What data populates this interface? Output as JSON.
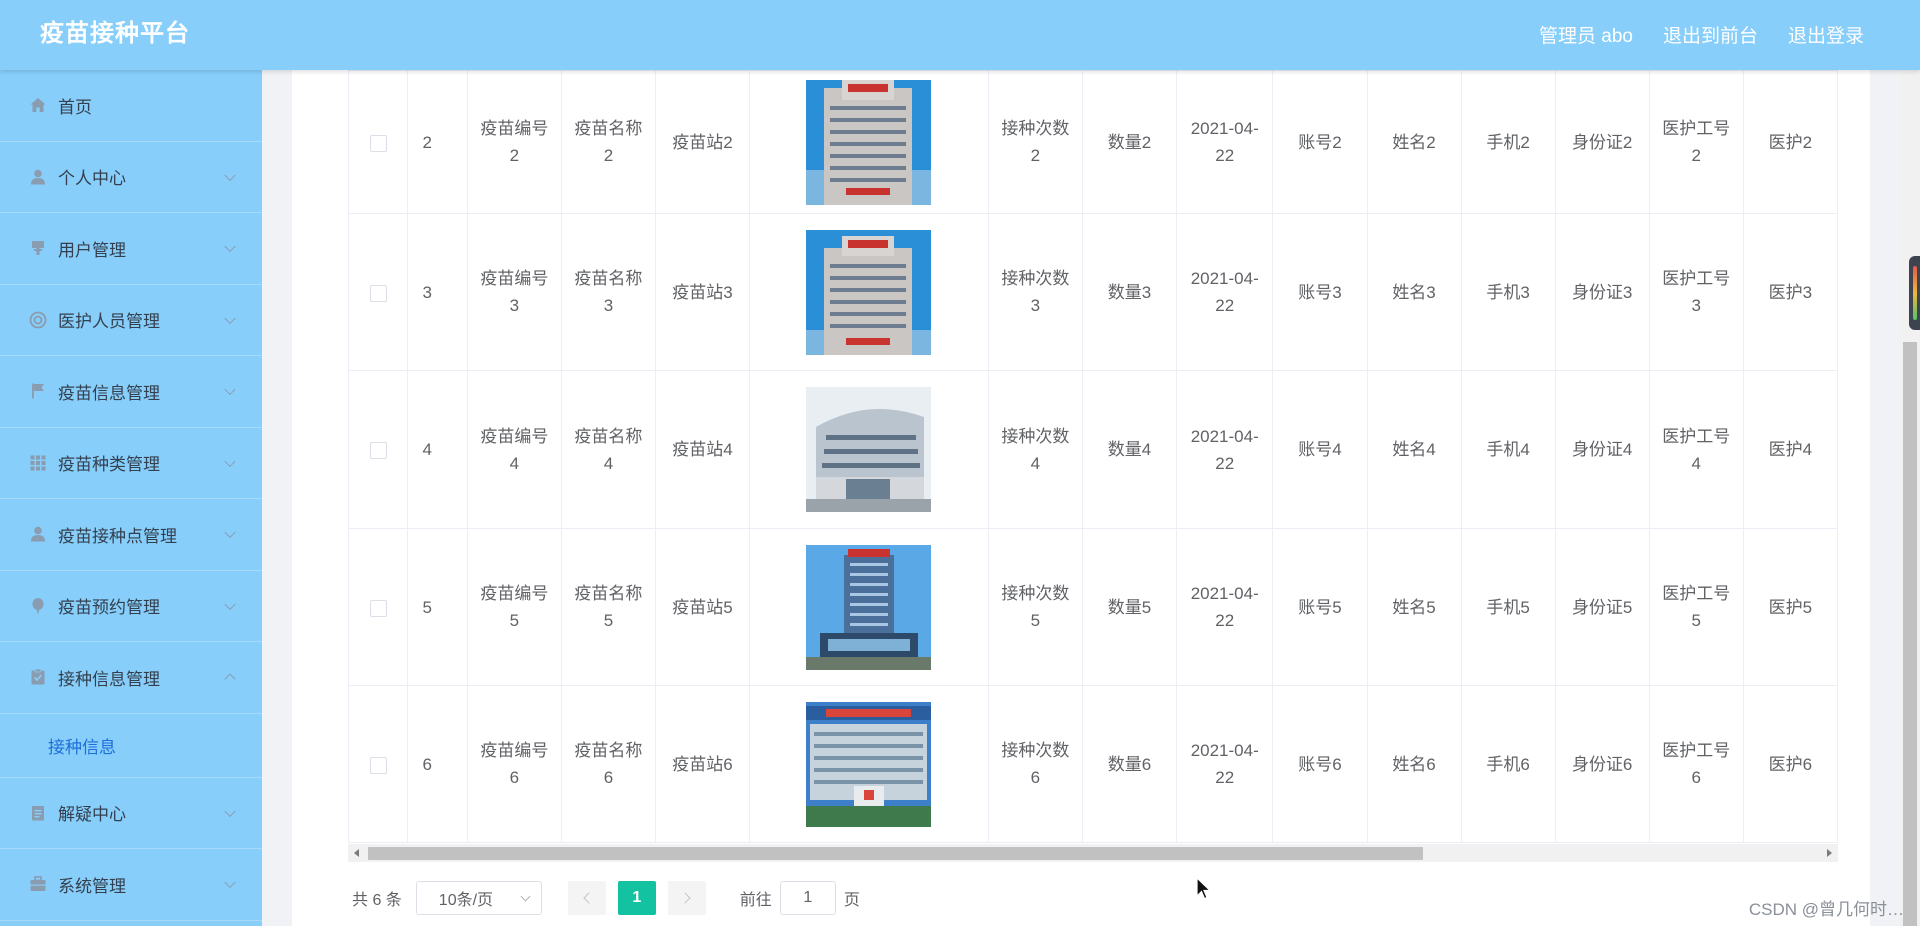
{
  "header": {
    "title": "疫苗接种平台",
    "user_label": "管理员 abo",
    "front_link": "退出到前台",
    "logout_link": "退出登录"
  },
  "sidebar": {
    "items": [
      {
        "label": "首页",
        "icon": "home-icon",
        "expandable": false
      },
      {
        "label": "个人中心",
        "icon": "user-icon",
        "expandable": true
      },
      {
        "label": "用户管理",
        "icon": "users-icon",
        "expandable": true
      },
      {
        "label": "医护人员管理",
        "icon": "lifebuoy-icon",
        "expandable": true
      },
      {
        "label": "疫苗信息管理",
        "icon": "flag-icon",
        "expandable": true
      },
      {
        "label": "疫苗种类管理",
        "icon": "grid-icon",
        "expandable": true
      },
      {
        "label": "疫苗接种点管理",
        "icon": "person-icon",
        "expandable": true
      },
      {
        "label": "疫苗预约管理",
        "icon": "balloon-icon",
        "expandable": true
      },
      {
        "label": "接种信息管理",
        "icon": "clipboard-check-icon",
        "expandable": true,
        "open": true
      },
      {
        "label": "解疑中心",
        "icon": "document-icon",
        "expandable": true
      },
      {
        "label": "系统管理",
        "icon": "briefcase-icon",
        "expandable": true
      }
    ],
    "submenu": {
      "label": "接种信息"
    }
  },
  "table": {
    "rows": [
      {
        "index": "2",
        "code": "疫苗编号2",
        "name": "疫苗名称2",
        "station": "疫苗站2",
        "times": "接种次数2",
        "qty": "数量2",
        "date": "2021-04-22",
        "account": "账号2",
        "person": "姓名2",
        "phone": "手机2",
        "idcard": "身份证2",
        "staff_id": "医护工号2",
        "staff_name": "医护2"
      },
      {
        "index": "3",
        "code": "疫苗编号3",
        "name": "疫苗名称3",
        "station": "疫苗站3",
        "times": "接种次数3",
        "qty": "数量3",
        "date": "2021-04-22",
        "account": "账号3",
        "person": "姓名3",
        "phone": "手机3",
        "idcard": "身份证3",
        "staff_id": "医护工号3",
        "staff_name": "医护3"
      },
      {
        "index": "4",
        "code": "疫苗编号4",
        "name": "疫苗名称4",
        "station": "疫苗站4",
        "times": "接种次数4",
        "qty": "数量4",
        "date": "2021-04-22",
        "account": "账号4",
        "person": "姓名4",
        "phone": "手机4",
        "idcard": "身份证4",
        "staff_id": "医护工号4",
        "staff_name": "医护4"
      },
      {
        "index": "5",
        "code": "疫苗编号5",
        "name": "疫苗名称5",
        "station": "疫苗站5",
        "times": "接种次数5",
        "qty": "数量5",
        "date": "2021-04-22",
        "account": "账号5",
        "person": "姓名5",
        "phone": "手机5",
        "idcard": "身份证5",
        "staff_id": "医护工号5",
        "staff_name": "医护5"
      },
      {
        "index": "6",
        "code": "疫苗编号6",
        "name": "疫苗名称6",
        "station": "疫苗站6",
        "times": "接种次数6",
        "qty": "数量6",
        "date": "2021-04-22",
        "account": "账号6",
        "person": "姓名6",
        "phone": "手机6",
        "idcard": "身份证6",
        "staff_id": "医护工号6",
        "staff_name": "医护6"
      }
    ]
  },
  "pagination": {
    "total": "共 6 条",
    "page_size": "10条/页",
    "current_page": "1",
    "goto_label": "前往",
    "goto_value": "1",
    "page_suffix": "页"
  },
  "watermark": "CSDN @曾几何时…",
  "colors": {
    "header_bg": "#87cefa",
    "sidebar_bg": "#87cefa",
    "active_submenu": "#1e6fd9",
    "page_active": "#13c2a0"
  }
}
